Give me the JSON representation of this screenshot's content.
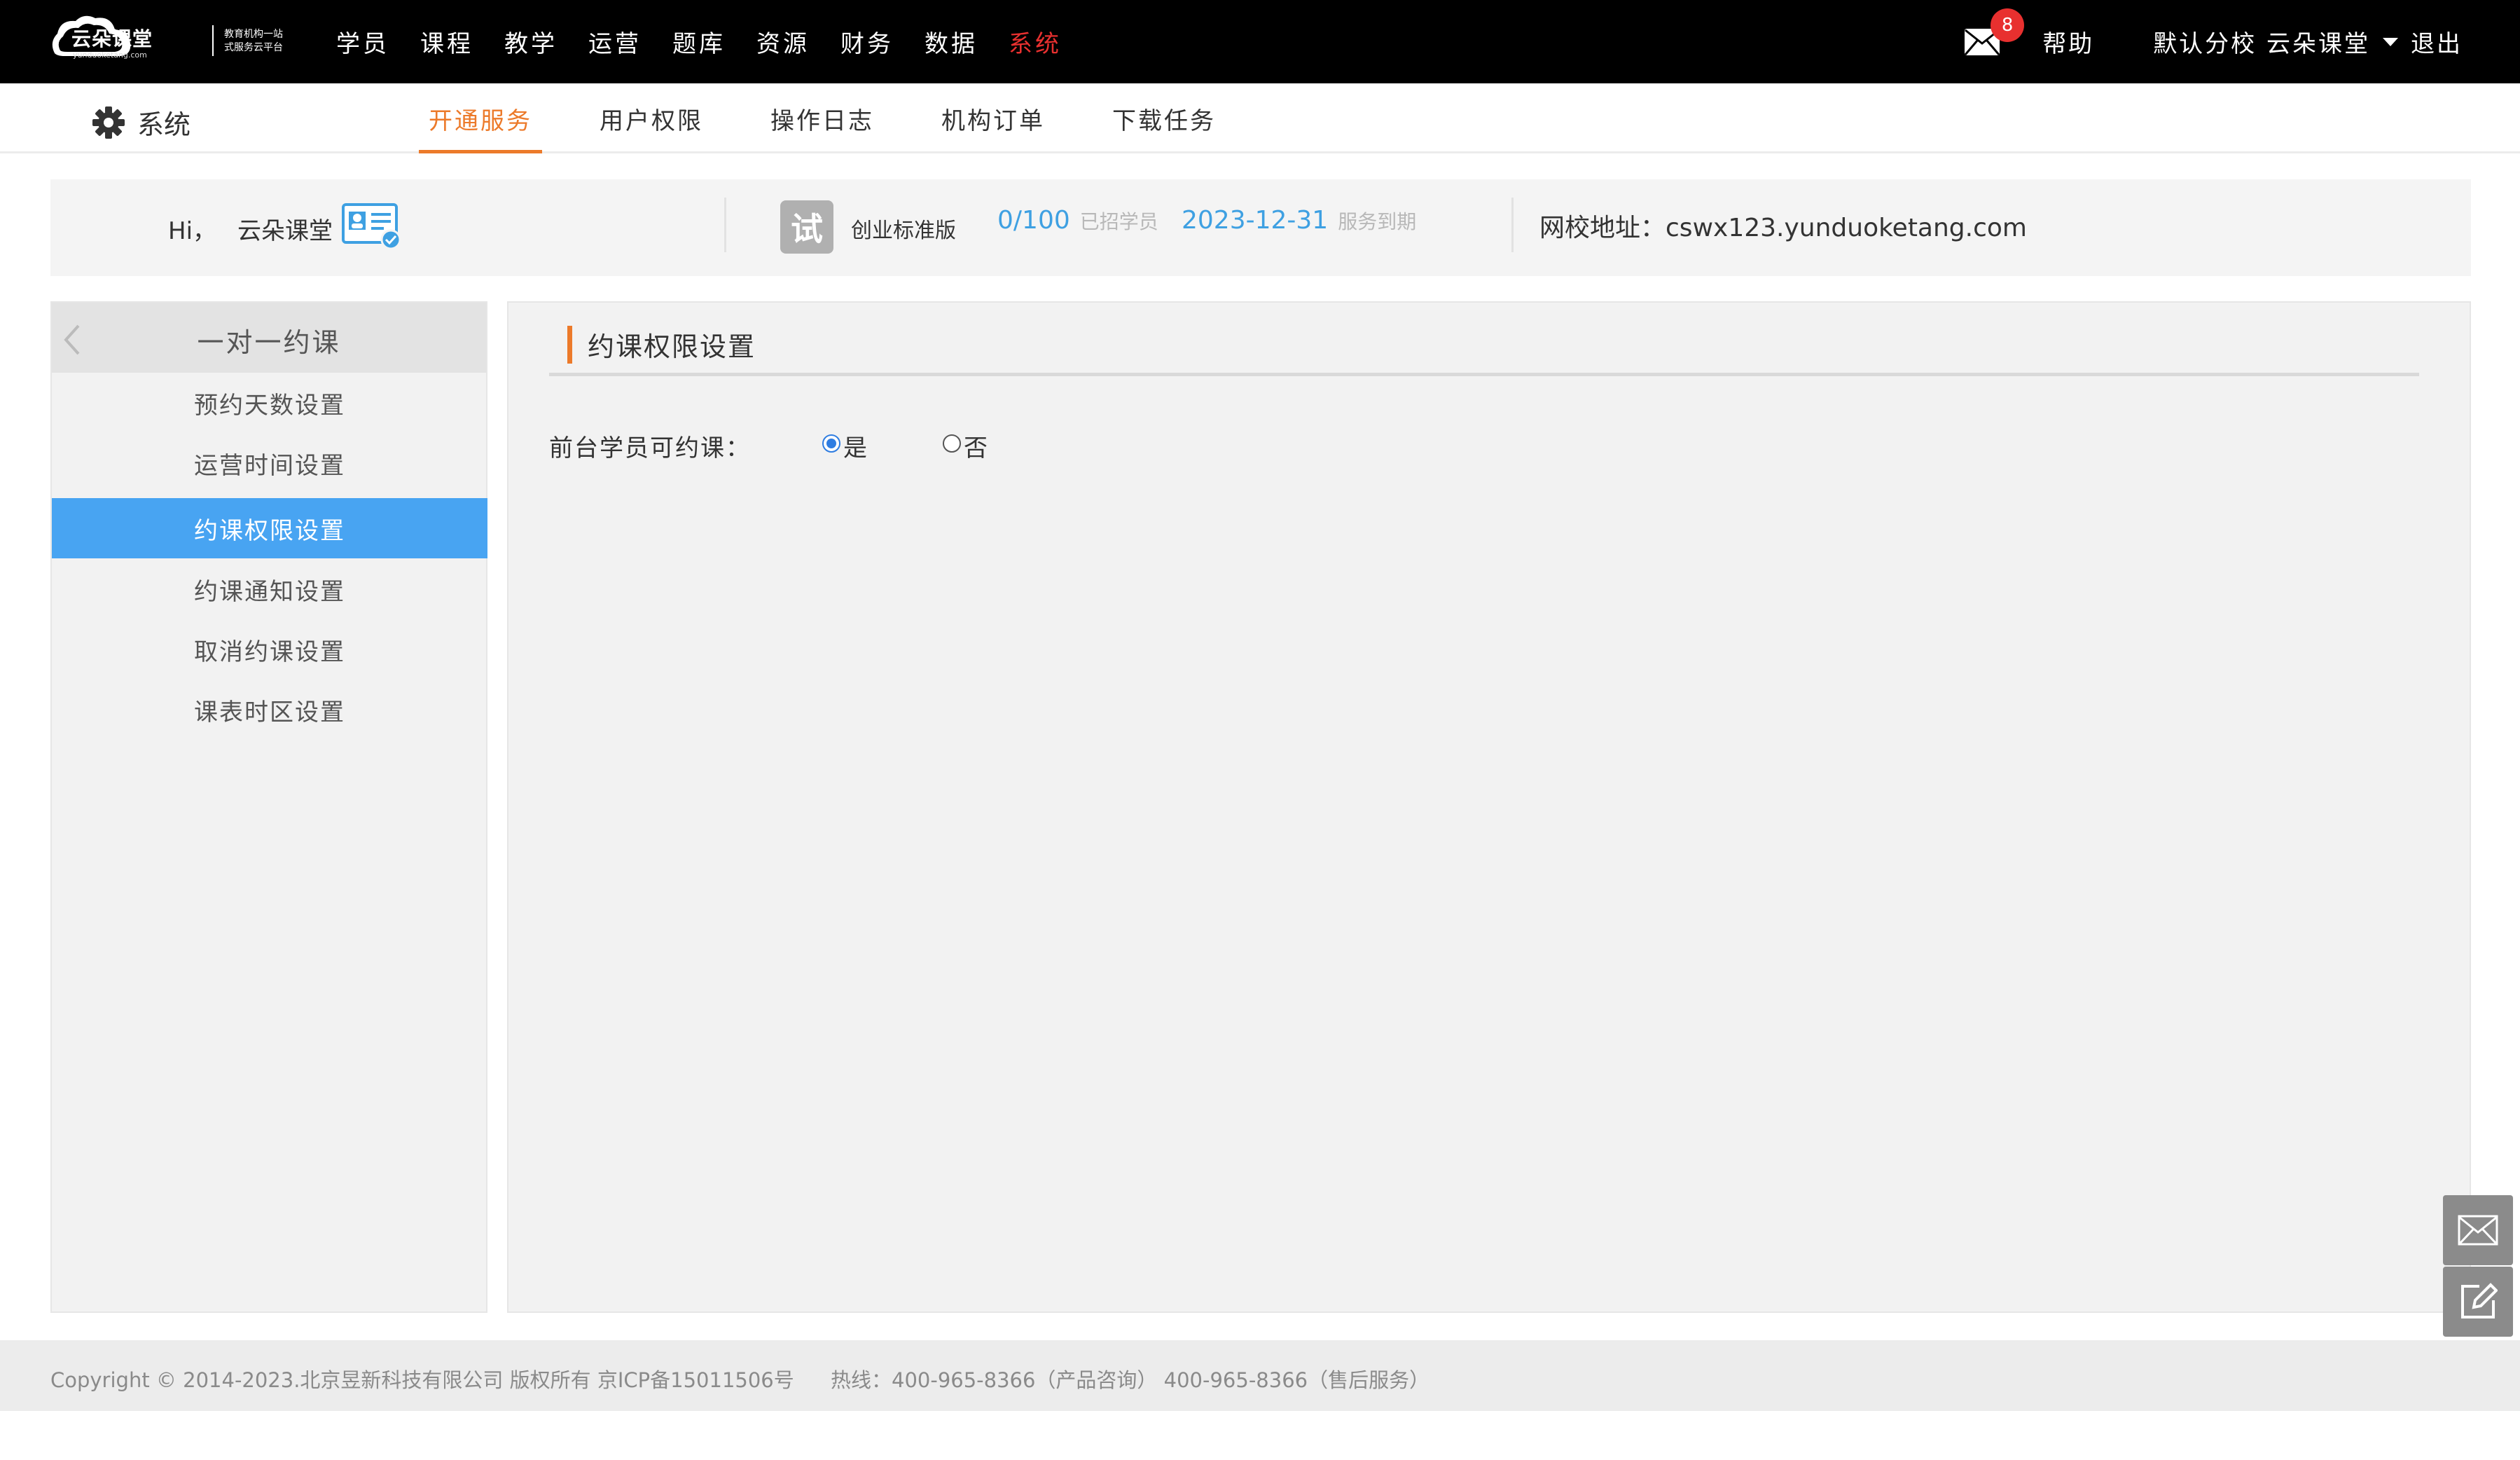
{
  "topnav": {
    "logo": {
      "name": "云朵课堂",
      "domain": "yunduoketang.com",
      "slogan_line1": "教育机构一站",
      "slogan_line2": "式服务云平台"
    },
    "items": [
      {
        "label": "学员"
      },
      {
        "label": "课程"
      },
      {
        "label": "教学"
      },
      {
        "label": "运营"
      },
      {
        "label": "题库"
      },
      {
        "label": "资源"
      },
      {
        "label": "财务"
      },
      {
        "label": "数据"
      },
      {
        "label": "系统"
      }
    ],
    "active_index": 8,
    "mail_count": "8",
    "help": "帮助",
    "school": "默认分校 云朵课堂",
    "logout": "退出"
  },
  "subnav": {
    "title": "系统",
    "tabs": [
      {
        "label": "开通服务"
      },
      {
        "label": "用户权限"
      },
      {
        "label": "操作日志"
      },
      {
        "label": "机构订单"
      },
      {
        "label": "下载任务"
      }
    ],
    "active_index": 0
  },
  "infobar": {
    "greeting": "Hi，",
    "user_name": "云朵课堂",
    "trial_badge": "试",
    "edition": "创业标准版",
    "students_value": "0/100",
    "students_label": "已招学员",
    "expire_value": "2023-12-31",
    "expire_label": "服务到期",
    "site_label": "网校地址：",
    "site_url": "cswx123.yunduoketang.com"
  },
  "leftmenu": {
    "header": "一对一约课",
    "items": [
      {
        "label": "预约天数设置"
      },
      {
        "label": "运营时间设置"
      },
      {
        "label": "约课权限设置"
      },
      {
        "label": "约课通知设置"
      },
      {
        "label": "取消约课设置"
      },
      {
        "label": "课表时区设置"
      }
    ],
    "active_index": 2
  },
  "content": {
    "title": "约课权限设置",
    "field_label": "前台学员可约课：",
    "options": [
      {
        "label": "是",
        "checked": true
      },
      {
        "label": "否",
        "checked": false
      }
    ]
  },
  "footer": {
    "copyright": "Copyright © 2014-2023.北京昱新科技有限公司 版权所有 京ICP备15011506号",
    "hotline": "热线：400-965-8366（产品咨询） 400-965-8366（售后服务）"
  },
  "colors": {
    "accent_orange": "#ec7a2a",
    "active_red": "#e8302f",
    "menu_blue": "#48a4f2",
    "stat_blue": "#3ea0e2"
  },
  "icons": {
    "mail": "envelope-icon",
    "settings": "gear-icon",
    "back": "chevron-left-icon",
    "card": "id-card-icon",
    "float_mail": "envelope-icon",
    "float_edit": "edit-icon"
  }
}
